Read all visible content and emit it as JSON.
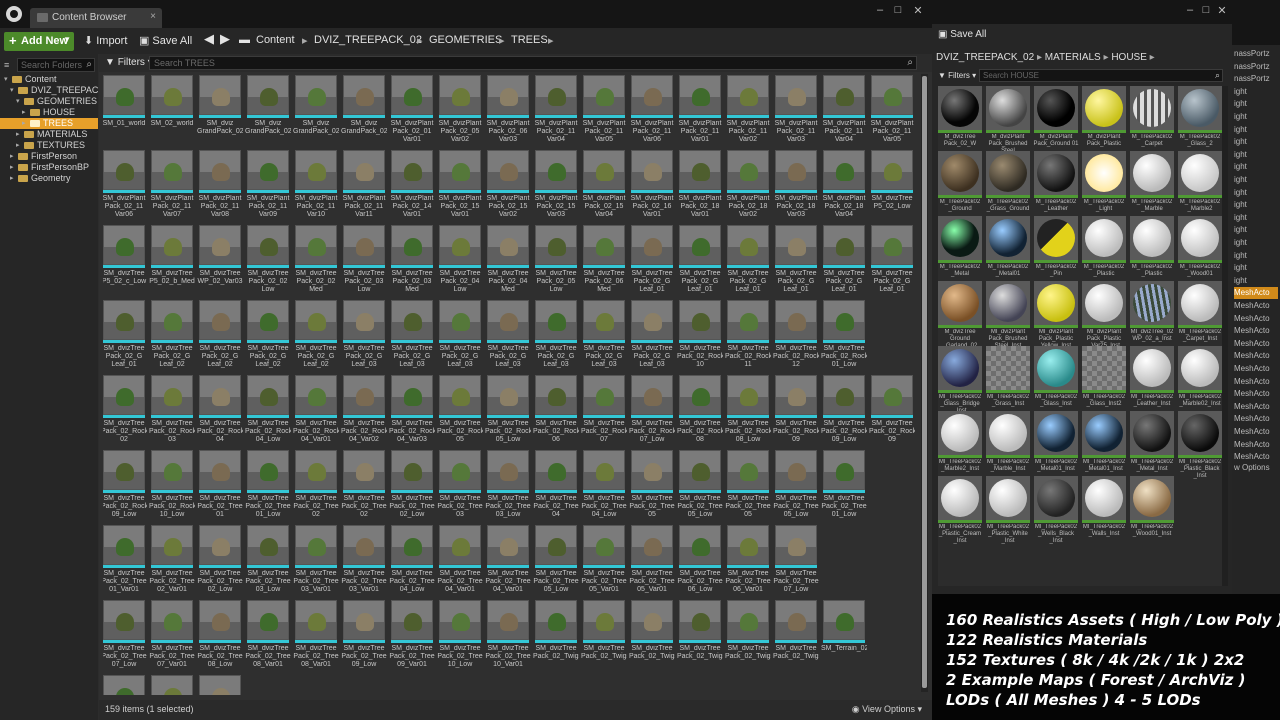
{
  "main_window": {
    "tab_title": "Content Browser",
    "toolbar": {
      "add_new": "Add New",
      "import": "Import",
      "save_all": "Save All"
    },
    "breadcrumbs": [
      "Content",
      "DVIZ_TREEPACK_02",
      "GEOMETRIES",
      "TREES"
    ],
    "sidebar": {
      "search_placeholder": "Search Folders",
      "tree": [
        {
          "label": "Content",
          "depth": 0,
          "expanded": true
        },
        {
          "label": "DVIZ_TREEPACK",
          "depth": 1,
          "expanded": true
        },
        {
          "label": "GEOMETRIES",
          "depth": 2,
          "expanded": true
        },
        {
          "label": "HOUSE",
          "depth": 3
        },
        {
          "label": "TREES",
          "depth": 3,
          "selected": true
        },
        {
          "label": "MATERIALS",
          "depth": 2
        },
        {
          "label": "TEXTURES",
          "depth": 2
        },
        {
          "label": "FirstPerson",
          "depth": 1
        },
        {
          "label": "FirstPersonBP",
          "depth": 1
        },
        {
          "label": "Geometry",
          "depth": 1
        }
      ]
    },
    "filters_label": "Filters",
    "search_placeholder": "Search TREES",
    "assets": [
      [
        "SM_01_world",
        "SM_02_world",
        "SM_dviz GrandPack_02_W_Rock",
        "SM_dviz GrandPack_02_W_Rock",
        "SM_dviz GrandPack_02_W_Rock",
        "SM_dviz GrandPack_02_W_Rock",
        "SM_dvizPlant Pack_02_01 Var01",
        "SM_dvizPlant Pack_02_05 Var02",
        "SM_dvizPlant Pack_02_06 Var03",
        "SM_dvizPlant Pack_02_11 Var04",
        "SM_dvizPlant Pack_02_11 Var05",
        "SM_dvizPlant Pack_02_11 Var06",
        "SM_dvizPlant Pack_02_11 Var01",
        "SM_dvizPlant Pack_02_11 Var02",
        "SM_dvizPlant Pack_02_11 Var03",
        "SM_dvizPlant Pack_02_11 Var04",
        "SM_dvizPlant Pack_02_11 Var05"
      ],
      [
        "SM_dvizPlant Pack_02_11 Var06",
        "SM_dvizPlant Pack_02_11 Var07",
        "SM_dvizPlant Pack_02_11 Var08",
        "SM_dvizPlant Pack_02_11 Var09",
        "SM_dvizPlant Pack_02_11 Var10",
        "SM_dvizPlant Pack_02_11 Var11",
        "SM_dvizPlant Pack_02_14 Var01",
        "SM_dvizPlant Pack_02_15 Var01",
        "SM_dvizPlant Pack_02_15 Var02",
        "SM_dvizPlant Pack_02_15 Var03",
        "SM_dvizPlant Pack_02_15 Var04",
        "SM_dvizPlant Pack_02_16 Var01",
        "SM_dvizPlant Pack_02_18 Var01",
        "SM_dvizPlant Pack_02_18 Var02",
        "SM_dvizPlant Pack_02_18 Var03",
        "SM_dvizPlant Pack_02_18 Var04",
        "SM_dvizTree P5_02_Low"
      ],
      [
        "SM_dvizTree P5_02_c_Low",
        "SM_dvizTree P5_02_b_Med",
        "SM_dvizTree WP_02_Var03",
        "SM_dvizTree Pack_02_02 Low",
        "SM_dvizTree Pack_02_02 Med",
        "SM_dvizTree Pack_02_03 Low",
        "SM_dvizTree Pack_02_03 Med",
        "SM_dvizTree Pack_02_04 Low",
        "SM_dvizTree Pack_02_04 Med",
        "SM_dvizTree Pack_02_05 Low",
        "SM_dvizTree Pack_02_06 Med",
        "SM_dvizTree Pack_02_G Leaf_01",
        "SM_dvizTree Pack_02_G Leaf_01",
        "SM_dvizTree Pack_02_G Leaf_01",
        "SM_dvizTree Pack_02_G Leaf_01",
        "SM_dvizTree Pack_02_G Leaf_01",
        "SM_dvizTree Pack_02_G Leaf_01"
      ],
      [
        "SM_dvizTree Pack_02_G Leaf_01",
        "SM_dvizTree Pack_02_G Leaf_02",
        "SM_dvizTree Pack_02_G Leaf_02",
        "SM_dvizTree Pack_02_G Leaf_02",
        "SM_dvizTree Pack_02_G Leaf_02",
        "SM_dvizTree Pack_02_G Leaf_03",
        "SM_dvizTree Pack_02_G Leaf_03",
        "SM_dvizTree Pack_02_G Leaf_03",
        "SM_dvizTree Pack_02_G Leaf_03",
        "SM_dvizTree Pack_02_G Leaf_03",
        "SM_dvizTree Pack_02_G Leaf_03",
        "SM_dvizTree Pack_02_G Leaf_03",
        "SM_dvizTree Pack_02_Rock 10",
        "SM_dvizTree Pack_02_Rock 11",
        "SM_dvizTree Pack_02_Rock 12",
        "SM_dvizTree Pack_02_Rock 01_Low"
      ],
      [
        "SM_dvizTree Pack_02_Rock 02",
        "SM_dvizTree Pack_02_Rock 03",
        "SM_dvizTree Pack_02_Rock 04",
        "SM_dvizTree Pack_02_Rock 04_Low",
        "SM_dvizTree Pack_02_Rock 04_Var01",
        "SM_dvizTree Pack_02_Rock 04_Var02",
        "SM_dvizTree Pack_02_Rock 04_Var03",
        "SM_dvizTree Pack_02_Rock 05",
        "SM_dvizTree Pack_02_Rock 05_Low",
        "SM_dvizTree Pack_02_Rock 06",
        "SM_dvizTree Pack_02_Rock 07",
        "SM_dvizTree Pack_02_Rock 07_Low",
        "SM_dvizTree Pack_02_Rock 08",
        "SM_dvizTree Pack_02_Rock 08_Low",
        "SM_dvizTree Pack_02_Rock 09",
        "SM_dvizTree Pack_02_Rock 09_Low",
        "SM_dvizTree Pack_02_Rock 09"
      ],
      [
        "SM_dvizTree Pack_02_Rock 09_Low",
        "SM_dvizTree Pack_02_Rock 10_Low",
        "SM_dvizTree Pack_02_Tree 01",
        "SM_dvizTree Pack_02_Tree 01_Low",
        "SM_dvizTree Pack_02_Tree 02",
        "SM_dvizTree Pack_02_Tree 02",
        "SM_dvizTree Pack_02_Tree 02_Low",
        "SM_dvizTree Pack_02_Tree 03",
        "SM_dvizTree Pack_02_Tree 03_Low",
        "SM_dvizTree Pack_02_Tree 04",
        "SM_dvizTree Pack_02_Tree 04_Low",
        "SM_dvizTree Pack_02_Tree 05",
        "SM_dvizTree Pack_02_Tree 05_Low",
        "SM_dvizTree Pack_02_Tree 05",
        "SM_dvizTree Pack_02_Tree 05_Low",
        "SM_dvizTree Pack_02_Tree 01_Low"
      ],
      [
        "SM_dvizTree Pack_02_Tree 01_Var01",
        "SM_dvizTree Pack_02_Tree 02_Var01",
        "SM_dvizTree Pack_02_Tree 02_Low",
        "SM_dvizTree Pack_02_Tree 03_Low",
        "SM_dvizTree Pack_02_Tree 03_Var01",
        "SM_dvizTree Pack_02_Tree 03_Var01",
        "SM_dvizTree Pack_02_Tree 04_Low",
        "SM_dvizTree Pack_02_Tree 04_Var01",
        "SM_dvizTree Pack_02_Tree 04_Var01",
        "SM_dvizTree Pack_02_Tree 05_Low",
        "SM_dvizTree Pack_02_Tree 05_Var01",
        "SM_dvizTree Pack_02_Tree 05_Var01",
        "SM_dvizTree Pack_02_Tree 06_Low",
        "SM_dvizTree Pack_02_Tree 06_Var01",
        "SM_dvizTree Pack_02_Tree 07_Low"
      ],
      [
        "SM_dvizTree Pack_02_Tree 07_Low",
        "SM_dvizTree Pack_02_Tree 07_Var01",
        "SM_dvizTree Pack_02_Tree 08_Low",
        "SM_dvizTree Pack_02_Tree 08_Var01",
        "SM_dvizTree Pack_02_Tree 08_Var01",
        "SM_dvizTree Pack_02_Tree 09_Low",
        "SM_dvizTree Pack_02_Tree 09_Var01",
        "SM_dvizTree Pack_02_Tree 10_Low",
        "SM_dvizTree Pack_02_Tree 10_Var01",
        "SM_dvizTree Pack_02_Twigs_03",
        "SM_dvizTree Pack_02_Twigs_04",
        "SM_dvizTree Pack_02_Twigs_05",
        "SM_dvizTree Pack_02_Twigs_06",
        "SM_dvizTree Pack_02_Twigs_07",
        "SM_dvizTree Pack_02_Twigs_09",
        "SM_Terrain_02"
      ],
      [
        "",
        "",
        ""
      ]
    ],
    "selected_asset": "SM_dvizTree Pack_02_G Leaf_03",
    "status": "159 items (1 selected)",
    "view_options": "View Options"
  },
  "materials_window": {
    "save_all": "Save All",
    "path": [
      "DVIZ_TREEPACK_02",
      "MATERIALS",
      "HOUSE"
    ],
    "filters_label": "Filters",
    "search_placeholder": "Search HOUSE",
    "materials": [
      [
        "M_dvizTree Pack_02_W",
        "M_dvizPlant Pack_Brushed Steel",
        "M_dvizPlant Pack_Ground 01",
        "M_dvizPlant Pack_Plastic",
        "M_TreePack02 _Carpet",
        "M_TreePack02 _Glass_2"
      ],
      [
        "M_TreePack02 _Ground",
        "M_TreePack02 _Grass_Ground",
        "M_TreePack02 _Leather",
        "M_TreePack02 _Light",
        "M_TreePack02 _Marble",
        "M_TreePack02 _Marble2"
      ],
      [
        "M_TreePack02 _Metal",
        "M_TreePack02 _Metal01",
        "M_TreePack02 _Pin",
        "M_TreePack02 _Plastic",
        "M_TreePack02 _Plastic",
        "M_TreePack02 _Wood01"
      ],
      [
        "M_dvizTree Ground _Garland_02",
        "MI_dvizPlant Pack_Brushed Steel_Inst",
        "MI_dvizPlant Pack_Plastic Yellow_Inst",
        "MI_dvizPlant Pack_Plastic _Var25_Inst",
        "MI_dvizTree_02 WP_02_a_Inst",
        "MI_TreePack02 _Carpet_Inst"
      ],
      [
        "MI_TreePack02 _Glass_Bridge _Inst",
        "MI_TreePack02 _Grass_Inst",
        "MI_TreePack02 _Glass_Inst",
        "MI_TreePack02 _Glass_Inst2",
        "MI_TreePack02 _Leather_Inst",
        "MI_TreePack02 _Marble02_Inst"
      ],
      [
        "MI_TreePack02 _Marble2_Inst",
        "MI_TreePack02 _Marble_Inst",
        "MI_TreePack02 _Metal01_Inst",
        "MI_TreePack02 _Metal01_Inst",
        "MI_TreePack02 _Metal_Inst",
        "MI_TreePack02 _Plastic_Black _Inst"
      ],
      [
        "MI_TreePack02 _Plastic_Cream _Inst",
        "MI_TreePack02 _Plastic_White _Inst",
        "MI_TreePack02 _Wells_Black _Inst",
        "MI_TreePack02 _Walls_Inst",
        "MI_TreePack02 _Wood01_Inst"
      ]
    ]
  },
  "far_panel": {
    "items": [
      "nassPortz",
      "nassPortz",
      "nassPortz",
      "ight",
      "ight",
      "ight",
      "ight",
      "ight",
      "ight",
      "ight",
      "ight",
      "ight",
      "ight",
      "ight",
      "ight",
      "ight",
      "ight",
      "ight",
      "ight",
      "MeshActo",
      "MeshActo",
      "MeshActo",
      "MeshActo",
      "MeshActo",
      "MeshActo",
      "MeshActo",
      "MeshActo",
      "MeshActo",
      "MeshActo",
      "MeshActo",
      "MeshActo",
      "MeshActo",
      "MeshActo",
      "w Options"
    ],
    "highlight_index": 19
  },
  "promo": {
    "lines": [
      "160 Realistics Assets ( High / Low Poly )",
      "122 Realistics Materials",
      "152 Textures ( 8k / 4k /2k / 1k ) 2x2",
      "2 Example Maps ( Forest / ArchViz )",
      "LODs ( All Meshes ) 4 - 5 LODs"
    ]
  },
  "colors": {
    "asset_bar": "#33c7d6",
    "material_bar": "#4f9a34",
    "selection": "#e7a02a",
    "add_new": "#4c8a2a"
  }
}
